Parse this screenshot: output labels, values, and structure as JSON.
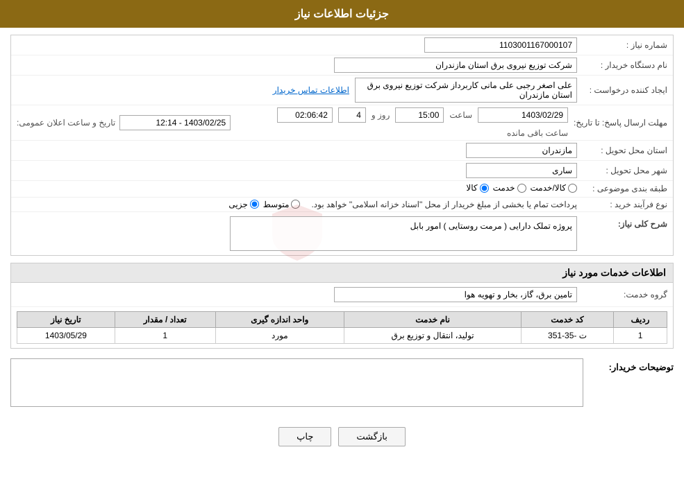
{
  "page": {
    "title": "جزئیات اطلاعات نیاز"
  },
  "header": {
    "title": "جزئیات اطلاعات نیاز"
  },
  "info": {
    "shomara_niyaz_label": "شماره نیاز :",
    "shomara_niyaz_value": "1103001167000107",
    "nam_dastgah_label": "نام دستگاه خریدار :",
    "nam_dastgah_value": "شرکت توزیع نیروی برق استان مازندران",
    "ijad_konande_label": "ایجاد کننده درخواست :",
    "ijad_konande_value": "علی اصغر رجبی علی مانی کاربرداز شرکت توزیع نیروی برق استان مازندران",
    "contact_link": "اطلاعات تماس خریدار",
    "mohlat_label": "مهلت ارسال پاسخ: تا تاریخ:",
    "date_value": "1403/02/29",
    "time_label": "ساعت",
    "time_value": "15:00",
    "day_label": "روز و",
    "day_value": "4",
    "remain_label": "ساعت باقی مانده",
    "remain_value": "02:06:42",
    "announce_label": "تاریخ و ساعت اعلان عمومی:",
    "announce_value": "1403/02/25 - 12:14",
    "ostan_label": "استان محل تحویل :",
    "ostan_value": "مازندران",
    "shahr_label": "شهر محل تحویل :",
    "shahr_value": "ساری",
    "tabaqe_label": "طبقه بندی موضوعی :",
    "radio_kala": "کالا",
    "radio_khedmat": "خدمت",
    "radio_kala_khedmat": "کالا/خدمت",
    "nooe_farayand_label": "نوع فرآیند خرید :",
    "radio_jozii": "جزیی",
    "radio_motavaset": "متوسط",
    "farayand_note": "پرداخت تمام یا بخشی از مبلغ خریدار از محل \"اسناد خزانه اسلامی\" خواهد بود.",
    "sharh_label": "شرح کلی نیاز:",
    "sharh_value": "پروژه تملک دارایی ( مرمت روستایی ) امور بابل",
    "services_title": "اطلاعات خدمات مورد نیاز",
    "group_label": "گروه خدمت:",
    "group_value": "تامین برق، گاز، بخار و تهویه هوا",
    "table": {
      "columns": [
        "ردیف",
        "کد خدمت",
        "نام خدمت",
        "واحد اندازه گیری",
        "تعداد / مقدار",
        "تاریخ نیاز"
      ],
      "rows": [
        {
          "radif": "1",
          "kod_khedmat": "ت -35-351",
          "nam_khedmat": "تولید، انتقال و توزیع برق",
          "vahed": "مورد",
          "tedad": "1",
          "tarikh": "1403/05/29"
        }
      ]
    },
    "toseeh_label": "توضیحات خریدار:",
    "toseeh_value": ""
  },
  "buttons": {
    "back": "بازگشت",
    "print": "چاپ"
  }
}
